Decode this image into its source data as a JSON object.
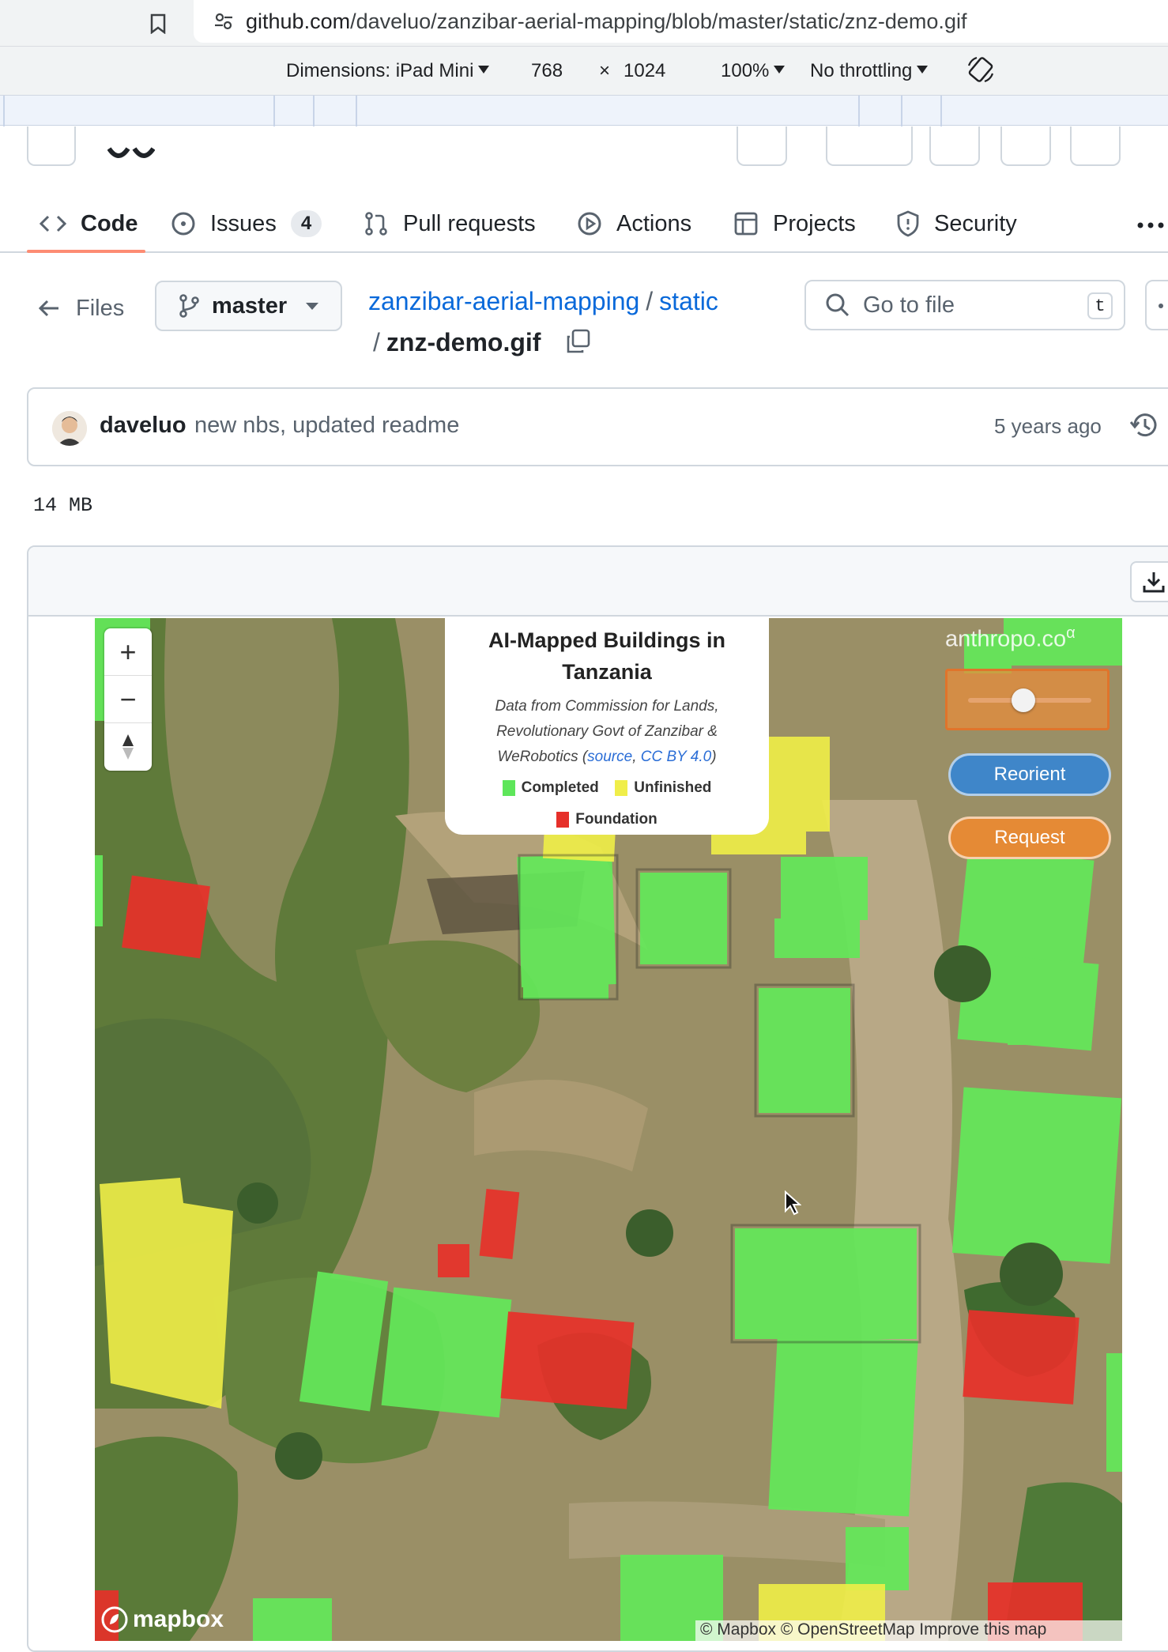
{
  "browser": {
    "url_host": "github.com",
    "url_path": "/daveluo/zanzibar-aerial-mapping/blob/master/static/znz-demo.gif",
    "devtools": {
      "dimensions": "Dimensions: iPad Mini",
      "width": "768",
      "times": "×",
      "height": "1024",
      "zoom": "100%",
      "throttling": "No throttling"
    }
  },
  "repo_nav": {
    "tabs": [
      {
        "label": "Code",
        "icon": "code-icon",
        "selected": true
      },
      {
        "label": "Issues",
        "icon": "issue-icon",
        "count": "4"
      },
      {
        "label": "Pull requests",
        "icon": "pull-request-icon"
      },
      {
        "label": "Actions",
        "icon": "play-icon"
      },
      {
        "label": "Projects",
        "icon": "table-icon"
      },
      {
        "label": "Security",
        "icon": "shield-icon"
      }
    ]
  },
  "file_header": {
    "files_label": "Files",
    "branch": "master",
    "repo": "zanzibar-aerial-mapping",
    "sep": "/",
    "folder": "static",
    "file": "znz-demo.gif",
    "goto_placeholder": "Go to file",
    "goto_shortcut": "t"
  },
  "commit": {
    "author": "daveluo",
    "message": "new nbs, updated readme",
    "time": "5 years ago"
  },
  "file_size": "14 MB",
  "map": {
    "legend": {
      "title_line1": "AI-Mapped Buildings in",
      "title_line2": "Tanzania",
      "desc_line1": "Data from Commission for Lands,",
      "desc_line2": "Revolutionary Govt of Zanzibar &",
      "desc_line3_a": "WeRobotics (",
      "desc_link1": "source",
      "desc_comma": ", ",
      "desc_link2": "CC BY 4.0",
      "desc_close": ")",
      "items": [
        {
          "label": "Completed",
          "color": "#5ee65a"
        },
        {
          "label": "Unfinished",
          "color": "#f0ee4a"
        },
        {
          "label": "Foundation",
          "color": "#e6302a"
        }
      ]
    },
    "brand": "anthropo.co",
    "brand_sup": "α",
    "zoom_in": "+",
    "zoom_out": "−",
    "reorient_label": "Reorient",
    "request_label": "Request",
    "mapbox": "mapbox",
    "attribution": "© Mapbox © OpenStreetMap  Improve this map",
    "slider_level": 0.45
  }
}
